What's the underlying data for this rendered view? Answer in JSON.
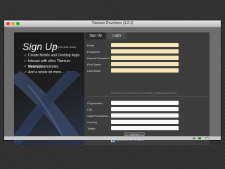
{
  "window": {
    "title": "Titanium Developer (1.2.1)"
  },
  "tabs": [
    {
      "label": "Sign Up",
      "active": true
    },
    {
      "label": "Login",
      "active": false
    }
  ],
  "promo": {
    "title": "Sign Up",
    "subtitle": "(It's free and cool!)",
    "bullets": [
      "Create Mobile and Desktop Apps",
      "Interact with other Titanium Developers",
      "View video tutorials",
      "And a whole lot more..."
    ]
  },
  "form": {
    "required_fields": [
      {
        "label": "Email",
        "value": ""
      },
      {
        "label": "Password",
        "value": ""
      },
      {
        "label": "Repeat Password",
        "value": ""
      },
      {
        "label": "First Name",
        "value": ""
      },
      {
        "label": "Last Name",
        "value": ""
      }
    ],
    "note": "These fields are optional but may be helpful for mobile related features",
    "optional_fields": [
      {
        "label": "Organization",
        "value": ""
      },
      {
        "label": "City",
        "value": ""
      },
      {
        "label": "State/Providence",
        "value": ""
      },
      {
        "label": "Country",
        "value": ""
      },
      {
        "label": "Twitter",
        "value": ""
      }
    ],
    "submit_label": "Sign Up",
    "terms_label": "I agree to the Terms of Service"
  },
  "colors": {
    "required_field_bg": "#f5e6b8",
    "accent_check": "#7ac143"
  }
}
